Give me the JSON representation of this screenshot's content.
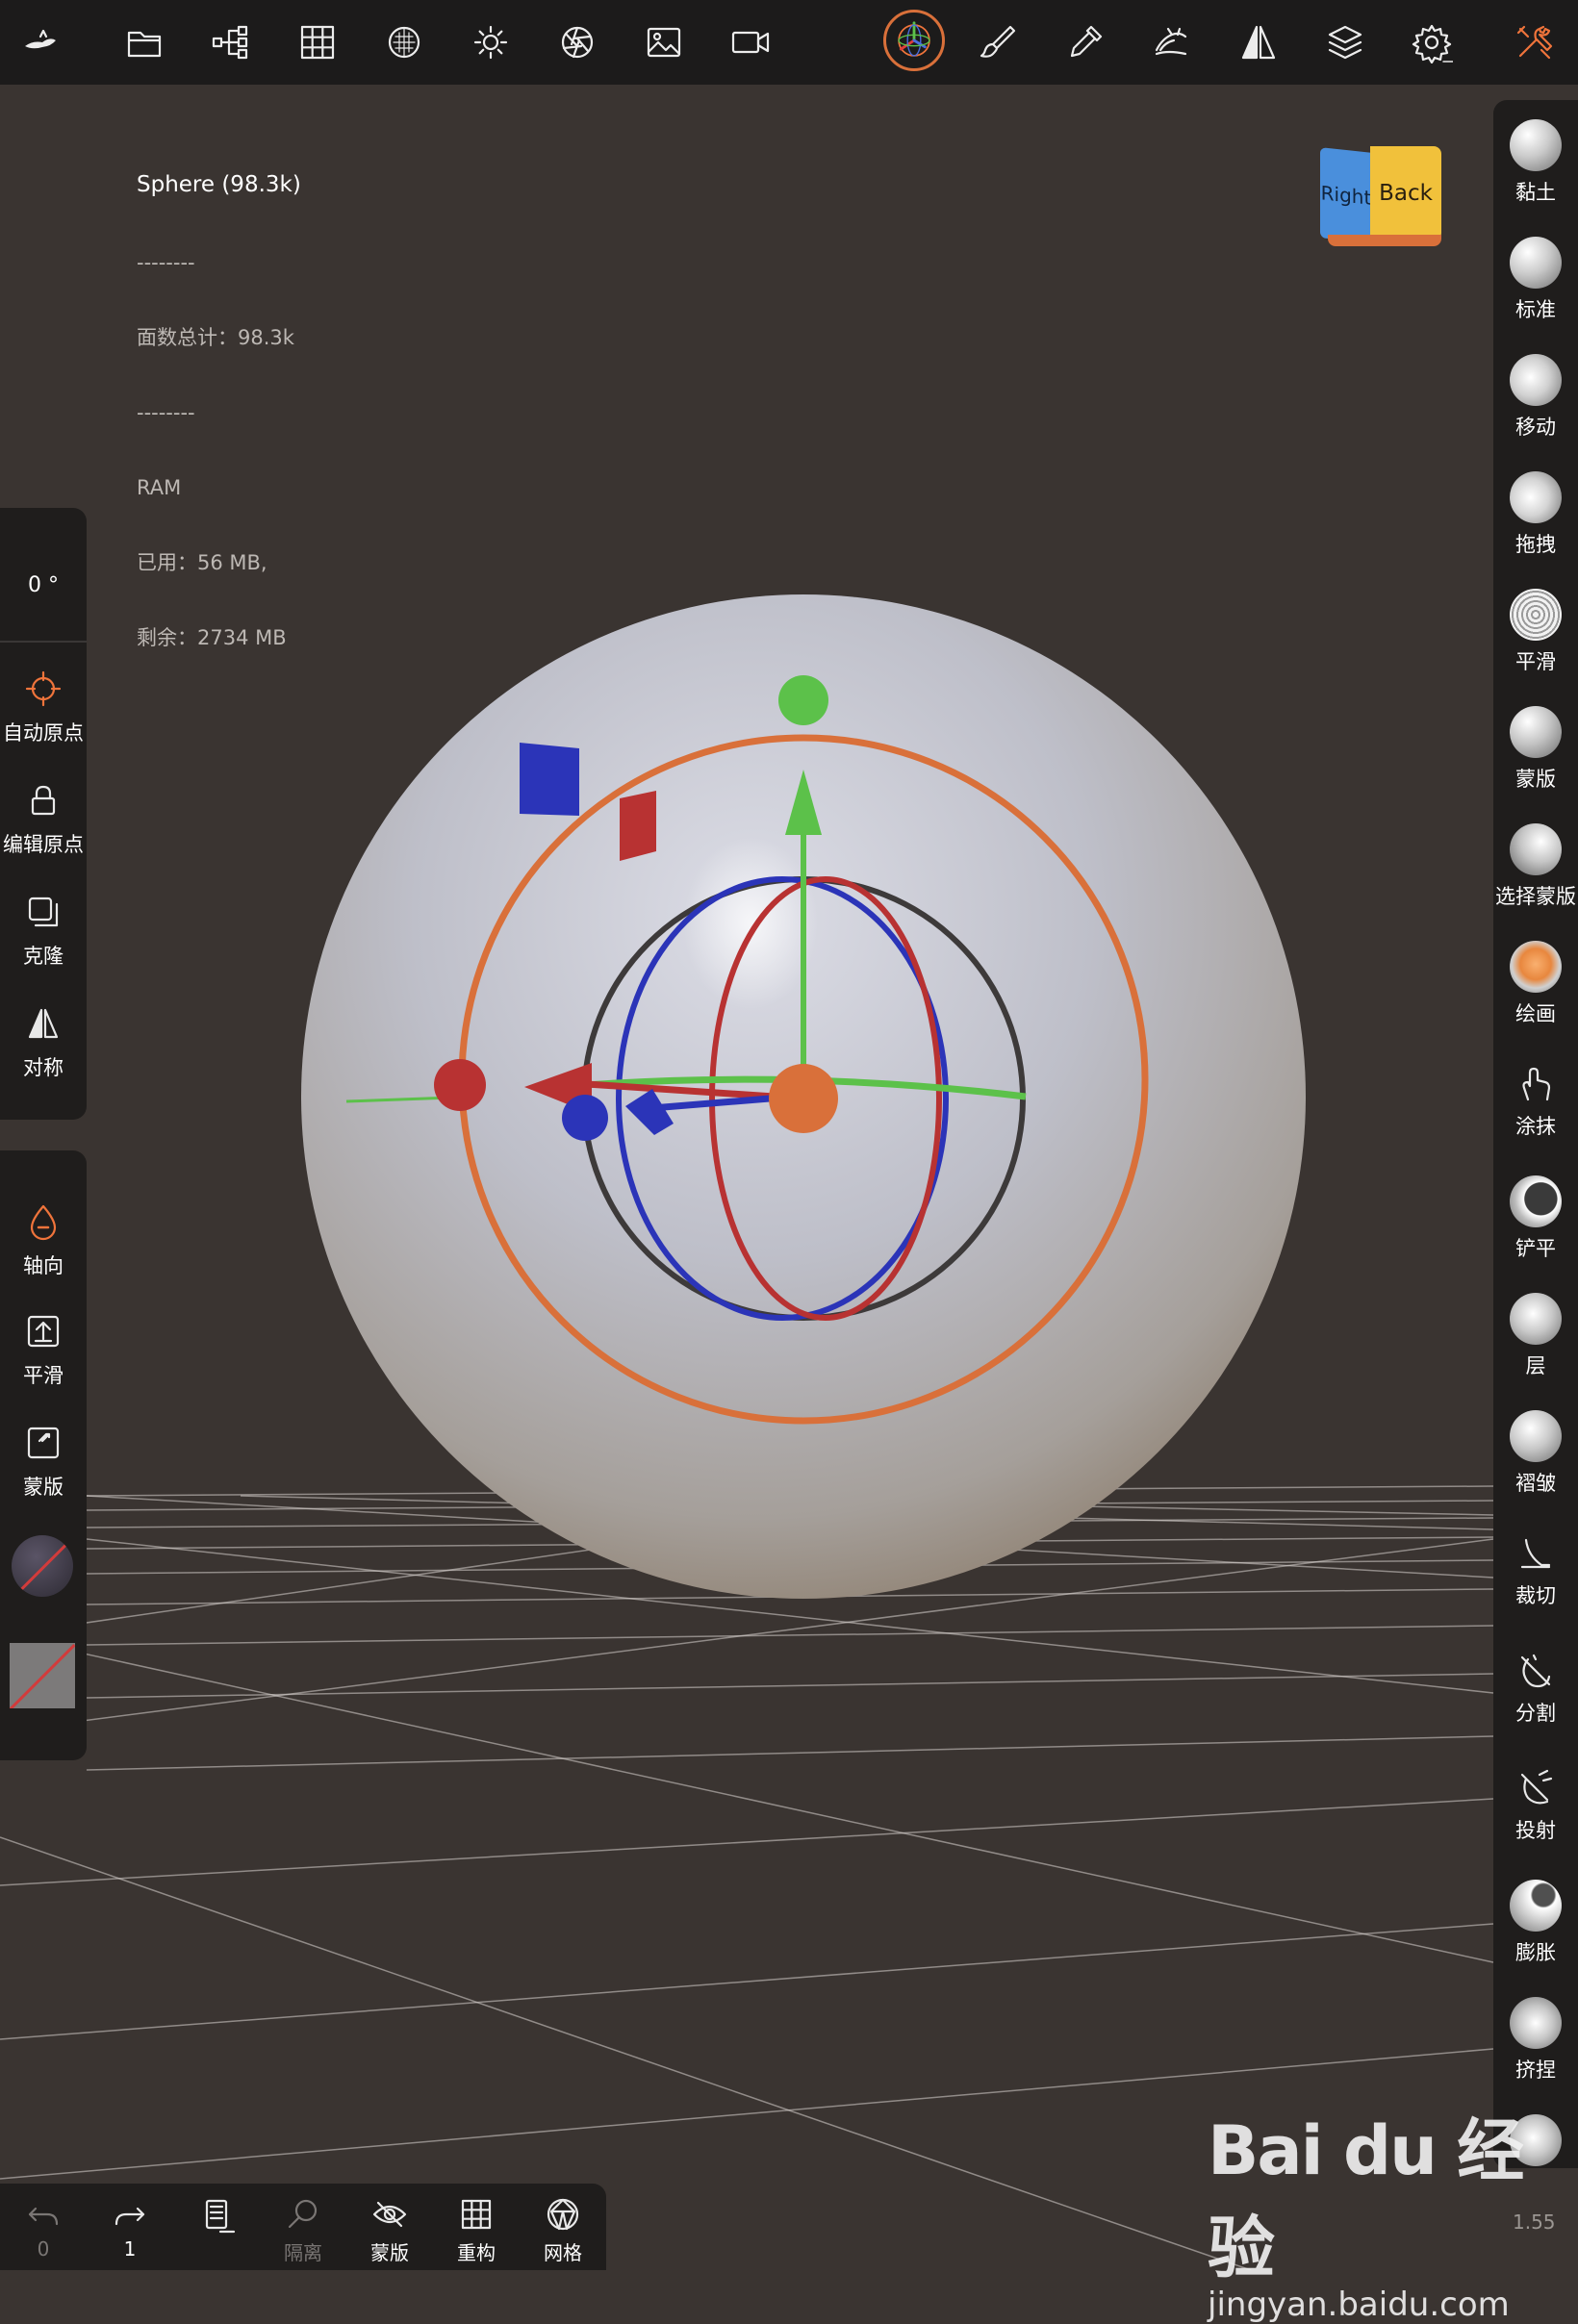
{
  "stats": {
    "object_name": "Sphere (98.3k)",
    "sep1": "--------",
    "faces_label": "面数总计：",
    "faces_value": "98.3k",
    "sep2": "--------",
    "ram_label": "RAM",
    "used_label": "已用：",
    "used_value": "56 MB,",
    "free_label": "剩余：",
    "free_value": "2734 MB"
  },
  "top_toolbar": {
    "icons": [
      "logo-icon",
      "open-folder-icon",
      "scene-tree-icon",
      "topology-grid-icon",
      "material-sphere-icon",
      "light-icon",
      "render-aperture-icon",
      "background-image-icon",
      "camera-icon",
      "gizmo-icon",
      "paint-brush-icon",
      "dropper-icon",
      "hand-stroke-icon",
      "symmetry-icon",
      "layers-icon",
      "settings-icon",
      "tools-icon"
    ],
    "active_color": "#f0743b"
  },
  "view_cube": {
    "right": "Right",
    "back": "Back"
  },
  "left_panel": {
    "angle": "0 °",
    "tools": [
      {
        "label": "自动原点"
      },
      {
        "label": "编辑原点"
      },
      {
        "label": "克隆"
      },
      {
        "label": "对称"
      }
    ],
    "tools2": [
      {
        "label": "轴向"
      },
      {
        "label": "平滑"
      },
      {
        "label": "蒙版"
      }
    ]
  },
  "right_panel": {
    "tools": [
      {
        "label": "黏土"
      },
      {
        "label": "标准"
      },
      {
        "label": "移动"
      },
      {
        "label": "拖拽"
      },
      {
        "label": "平滑"
      },
      {
        "label": "蒙版"
      },
      {
        "label": "选择蒙版"
      },
      {
        "label": "绘画"
      },
      {
        "label": "涂抹"
      },
      {
        "label": "铲平"
      },
      {
        "label": "层"
      },
      {
        "label": "褶皱"
      },
      {
        "label": "裁切"
      },
      {
        "label": "分割"
      },
      {
        "label": "投射"
      },
      {
        "label": "膨胀"
      },
      {
        "label": "挤捏"
      }
    ]
  },
  "bottom_bar": {
    "undo_count": "0",
    "redo_count": "1",
    "isolate": "隔离",
    "mask": "蒙版",
    "remesh": "重构",
    "mesh": "网格"
  },
  "zoom": "1.55",
  "watermark": {
    "brand": "Bai du 经验",
    "url": "jingyan.baidu.com"
  }
}
